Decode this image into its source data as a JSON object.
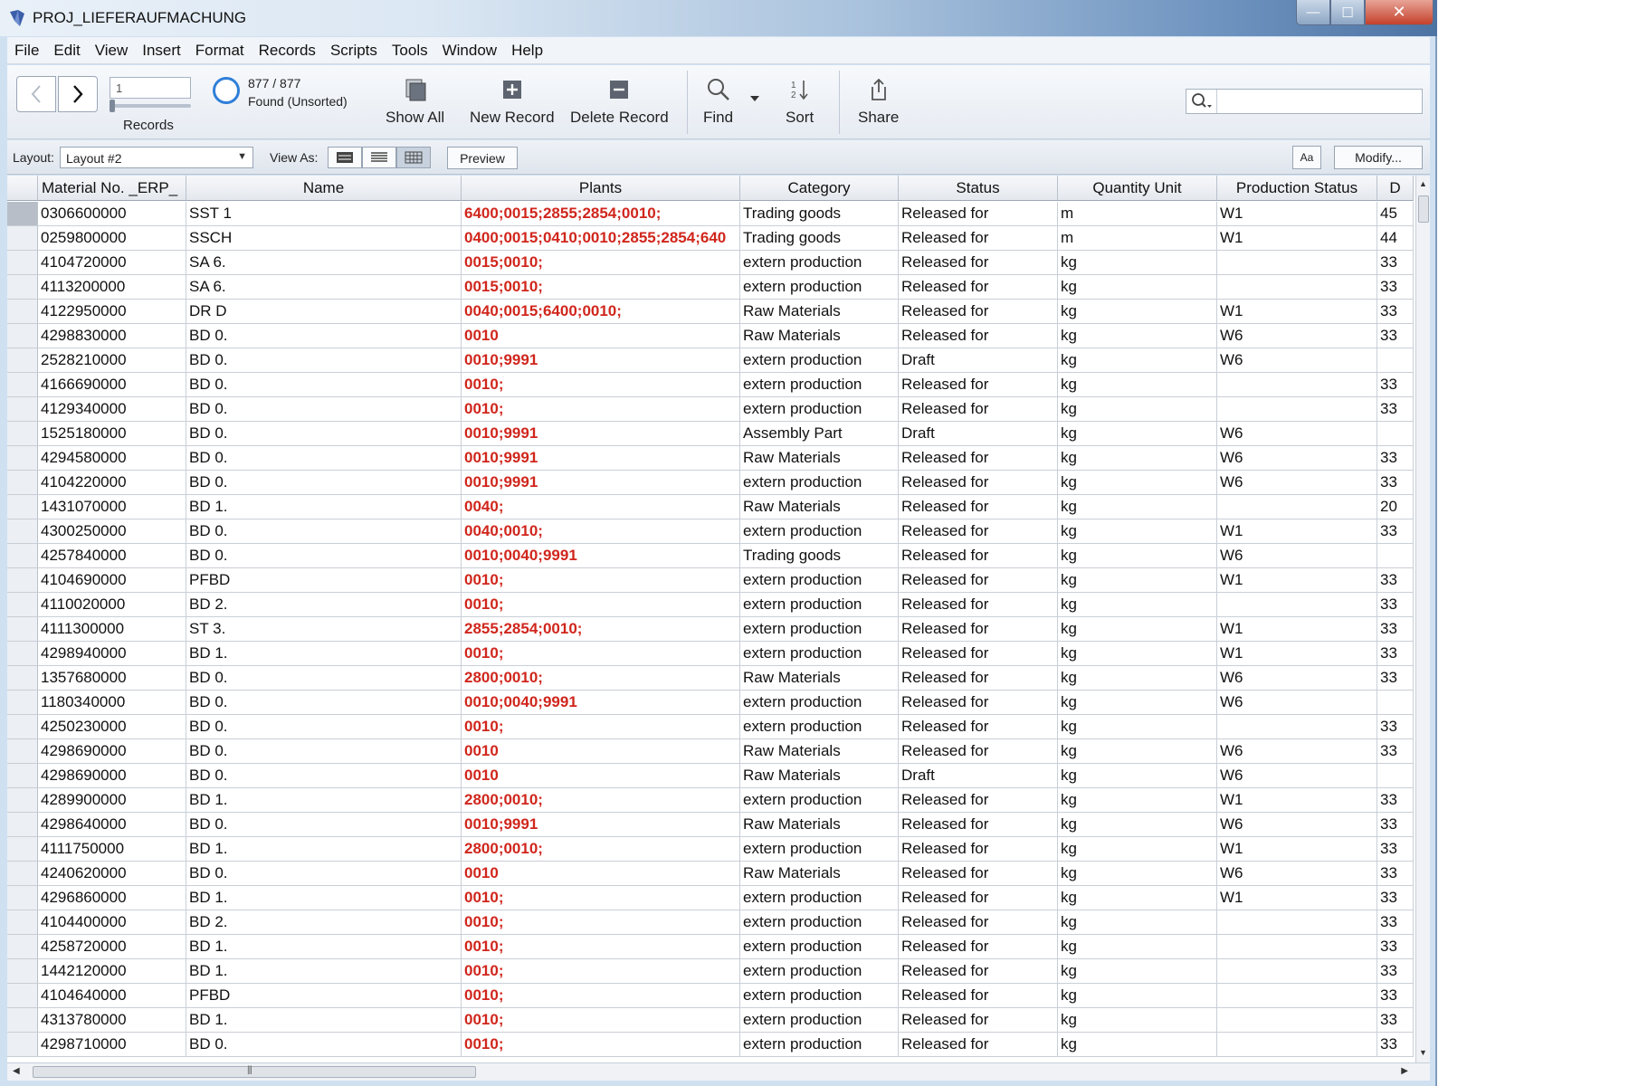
{
  "window": {
    "title": "PROJ_LIEFERAUFMACHUNG",
    "controls": {
      "minimize": "—",
      "maximize": "☐",
      "close": "✕"
    }
  },
  "menu": [
    "File",
    "Edit",
    "View",
    "Insert",
    "Format",
    "Records",
    "Scripts",
    "Tools",
    "Window",
    "Help"
  ],
  "toolbar": {
    "record_value": "1",
    "records_label": "Records",
    "found_count": "877 / 877",
    "found_status": "Found (Unsorted)",
    "show_all": "Show All",
    "new_record": "New Record",
    "delete_record": "Delete Record",
    "find": "Find",
    "sort": "Sort",
    "share": "Share",
    "search_placeholder": ""
  },
  "layoutbar": {
    "layout_label": "Layout:",
    "layout_value": "Layout #2",
    "viewas_label": "View As:",
    "preview": "Preview",
    "aa": "Aa",
    "modify": "Modify..."
  },
  "table": {
    "columns": [
      "Material No. _ERP_",
      "Name",
      "Plants",
      "Category",
      "Status",
      "Quantity Unit",
      "Production Status",
      "D"
    ],
    "rows": [
      [
        "0306600000",
        "SST 1",
        "6400;0015;2855;2854;0010;",
        "Trading goods",
        "Released for",
        "m",
        "W1",
        "45"
      ],
      [
        "0259800000",
        "SSCH",
        "0400;0015;0410;0010;2855;2854;640",
        "Trading goods",
        "Released for",
        "m",
        "W1",
        "44"
      ],
      [
        "4104720000",
        "SA 6.",
        "0015;0010;",
        "extern production",
        "Released for",
        "kg",
        "",
        "33"
      ],
      [
        "4113200000",
        "SA 6.",
        "0015;0010;",
        "extern production",
        "Released for",
        "kg",
        "",
        "33"
      ],
      [
        "4122950000",
        "DR D",
        "0040;0015;6400;0010;",
        "Raw Materials",
        "Released for",
        "kg",
        "W1",
        "33"
      ],
      [
        "4298830000",
        "BD 0.",
        "0010",
        "Raw Materials",
        "Released for",
        "kg",
        "W6",
        "33"
      ],
      [
        "2528210000",
        "BD 0.",
        "0010;9991",
        "extern production",
        "Draft",
        "kg",
        "W6",
        ""
      ],
      [
        "4166690000",
        "BD 0.",
        "0010;",
        "extern production",
        "Released for",
        "kg",
        "",
        "33"
      ],
      [
        "4129340000",
        "BD 0.",
        "0010;",
        "extern production",
        "Released for",
        "kg",
        "",
        "33"
      ],
      [
        "1525180000",
        "BD 0.",
        "0010;9991",
        "Assembly Part",
        "Draft",
        "kg",
        "W6",
        ""
      ],
      [
        "4294580000",
        "BD 0.",
        "0010;9991",
        "Raw Materials",
        "Released for",
        "kg",
        "W6",
        "33"
      ],
      [
        "4104220000",
        "BD 0.",
        "0010;9991",
        "extern production",
        "Released for",
        "kg",
        "W6",
        "33"
      ],
      [
        "1431070000",
        "BD 1.",
        "0040;",
        "Raw Materials",
        "Released for",
        "kg",
        "",
        "20"
      ],
      [
        "4300250000",
        "BD 0.",
        "0040;0010;",
        "extern production",
        "Released for",
        "kg",
        "W1",
        "33"
      ],
      [
        "4257840000",
        "BD 0.",
        "0010;0040;9991",
        "Trading goods",
        "Released for",
        "kg",
        "W6",
        ""
      ],
      [
        "4104690000",
        "PFBD",
        "0010;",
        "extern production",
        "Released for",
        "kg",
        "W1",
        "33"
      ],
      [
        "4110020000",
        "BD 2.",
        "0010;",
        "extern production",
        "Released for",
        "kg",
        "",
        "33"
      ],
      [
        "4111300000",
        "ST 3.",
        "2855;2854;0010;",
        "extern production",
        "Released for",
        "kg",
        "W1",
        "33"
      ],
      [
        "4298940000",
        "BD 1.",
        "0010;",
        "extern production",
        "Released for",
        "kg",
        "W1",
        "33"
      ],
      [
        "1357680000",
        "BD 0.",
        "2800;0010;",
        "Raw Materials",
        "Released for",
        "kg",
        "W6",
        "33"
      ],
      [
        "1180340000",
        "BD 0.",
        "0010;0040;9991",
        "extern production",
        "Released for",
        "kg",
        "W6",
        ""
      ],
      [
        "4250230000",
        "BD 0.",
        "0010;",
        "extern production",
        "Released for",
        "kg",
        "",
        "33"
      ],
      [
        "4298690000",
        "BD 0.",
        "0010",
        "Raw Materials",
        "Released for",
        "kg",
        "W6",
        "33"
      ],
      [
        "4298690000",
        "BD 0.",
        "0010",
        "Raw Materials",
        "Draft",
        "kg",
        "W6",
        ""
      ],
      [
        "4289900000",
        "BD 1.",
        "2800;0010;",
        "extern production",
        "Released for",
        "kg",
        "W1",
        "33"
      ],
      [
        "4298640000",
        "BD 0.",
        "0010;9991",
        "Raw Materials",
        "Released for",
        "kg",
        "W6",
        "33"
      ],
      [
        "4111750000",
        "BD 1.",
        "2800;0010;",
        "extern production",
        "Released for",
        "kg",
        "W1",
        "33"
      ],
      [
        "4240620000",
        "BD 0.",
        "0010",
        "Raw Materials",
        "Released for",
        "kg",
        "W6",
        "33"
      ],
      [
        "4296860000",
        "BD 1.",
        "0010;",
        "extern production",
        "Released for",
        "kg",
        "W1",
        "33"
      ],
      [
        "4104400000",
        "BD 2.",
        "0010;",
        "extern production",
        "Released for",
        "kg",
        "",
        "33"
      ],
      [
        "4258720000",
        "BD 1.",
        "0010;",
        "extern production",
        "Released for",
        "kg",
        "",
        "33"
      ],
      [
        "1442120000",
        "BD 1.",
        "0010;",
        "extern production",
        "Released for",
        "kg",
        "",
        "33"
      ],
      [
        "4104640000",
        "PFBD",
        "0010;",
        "extern production",
        "Released for",
        "kg",
        "",
        "33"
      ],
      [
        "4313780000",
        "BD 1.",
        "0010;",
        "extern production",
        "Released for",
        "kg",
        "",
        "33"
      ],
      [
        "4298710000",
        "BD 0.",
        "0010;",
        "extern production",
        "Released for",
        "kg",
        "",
        "33"
      ]
    ]
  },
  "colors": {
    "plants_text": "#d0261c",
    "found_pie": "#2f7fd8"
  }
}
